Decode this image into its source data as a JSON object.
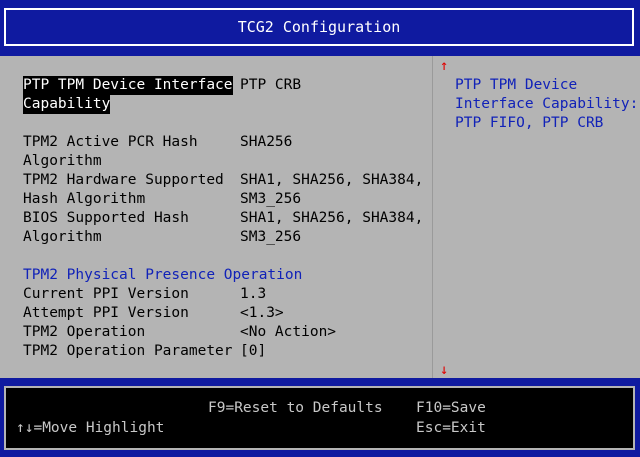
{
  "header": {
    "title": "TCG2 Configuration"
  },
  "settings": {
    "ptp_label_line1": "PTP TPM Device Interface",
    "ptp_label_line2": "Capability",
    "ptp_value": "PTP CRB",
    "pcr_label_line1": "TPM2 Active PCR Hash",
    "pcr_label_line2": "Algorithm",
    "pcr_value": "SHA256",
    "hw_label_line1": "TPM2 Hardware Supported",
    "hw_label_line2": "Hash Algorithm",
    "hw_value_line1": "SHA1, SHA256, SHA384,",
    "hw_value_line2": "SM3_256",
    "bios_label_line1": "BIOS Supported Hash",
    "bios_label_line2": "Algorithm",
    "bios_value_line1": "SHA1, SHA256, SHA384,",
    "bios_value_line2": "SM3_256"
  },
  "ppi_section": {
    "heading": "TPM2 Physical Presence Operation",
    "current_label": "Current PPI Version",
    "current_value": "1.3",
    "attempt_label": "Attempt PPI Version",
    "attempt_value": "<1.3>",
    "operation_label": "TPM2 Operation",
    "operation_value": "<No Action>",
    "param_label": "TPM2 Operation Parameter",
    "param_value": "[0]"
  },
  "help": {
    "text": "PTP TPM Device\nInterface Capability:\nPTP FIFO, PTP CRB"
  },
  "scroll": {
    "up_glyph": "↑",
    "down_glyph": "↓"
  },
  "footer": {
    "f9": "F9=Reset to Defaults",
    "f10": "F10=Save",
    "move": "↑↓=Move Highlight",
    "esc": "Esc=Exit"
  },
  "colors": {
    "background": "#0f1aa0",
    "panel": "#b4b4b4",
    "help_text": "#1122b8",
    "arrow": "#e00000"
  }
}
